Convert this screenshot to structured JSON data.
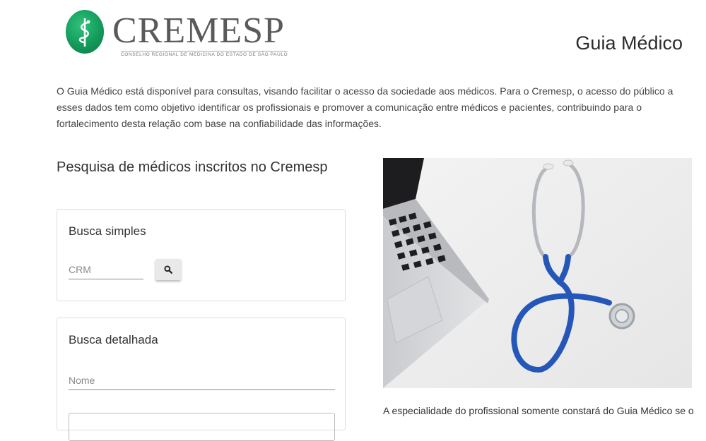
{
  "header": {
    "logo_text": "CREMESP",
    "logo_subtitle": "CONSELHO REGIONAL DE MEDICINA DO ESTADO DE SÃO PAULO",
    "page_title": "Guia Médico"
  },
  "intro": "O Guia Médico está disponível para consultas, visando facilitar o acesso da sociedade aos médicos. Para o Cremesp, o acesso do público a esses dados tem como objetivo identificar os profissionais e promover a comunicação entre médicos e pacientes, contribuindo para o fortalecimento desta relação com base na confiabilidade das informações.",
  "search": {
    "section_title": "Pesquisa de médicos inscritos no Cremesp",
    "simple": {
      "title": "Busca simples",
      "crm_placeholder": "CRM",
      "button_icon": "search-icon"
    },
    "detailed": {
      "title": "Busca detalhada",
      "name_placeholder": "Nome"
    }
  },
  "aside": {
    "image": "laptop-and-stethoscope-photo",
    "caption": "A especialidade do profissional somente constará do Guia Médico se o"
  },
  "colors": {
    "logo_green": "#139a5a",
    "stethoscope_blue": "#2457b8",
    "text": "#333333"
  }
}
